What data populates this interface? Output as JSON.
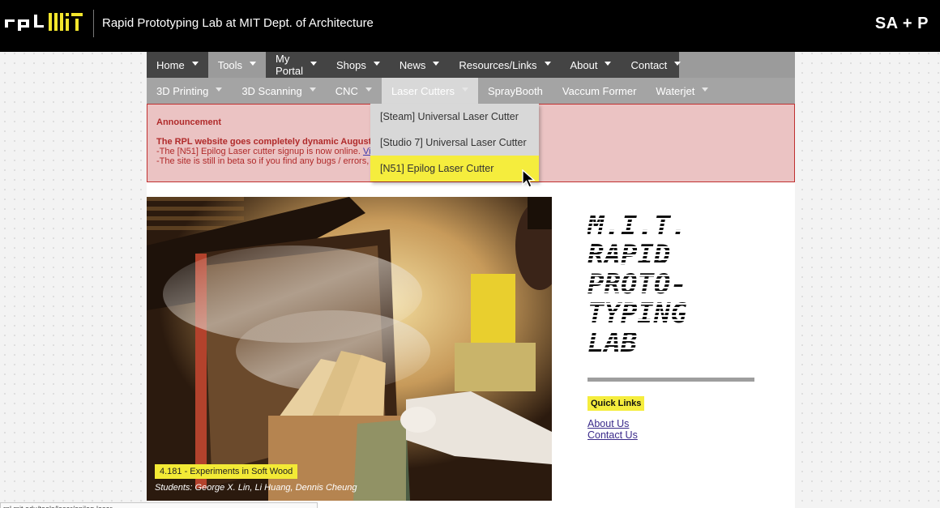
{
  "header": {
    "site_title": "Rapid Prototyping Lab at MIT Dept. of Architecture",
    "right_label": "SA + P",
    "logos": [
      "rpl-logo",
      "mit-logo"
    ]
  },
  "nav": {
    "primary": [
      {
        "label": "Home",
        "active": false
      },
      {
        "label": "Tools",
        "active": true
      },
      {
        "label": "My Portal",
        "active": false
      },
      {
        "label": "Shops",
        "active": false
      },
      {
        "label": "News",
        "active": false
      },
      {
        "label": "Resources/Links",
        "active": false
      },
      {
        "label": "About",
        "active": false
      },
      {
        "label": "Contact",
        "active": false
      }
    ],
    "secondary": [
      {
        "label": "3D Printing",
        "has_caret": true
      },
      {
        "label": "3D Scanning",
        "has_caret": true
      },
      {
        "label": "CNC",
        "has_caret": true
      },
      {
        "label": "Laser Cutters",
        "has_caret": true,
        "active": true
      },
      {
        "label": "SprayBooth",
        "has_caret": false
      },
      {
        "label": "Vaccum Former",
        "has_caret": false
      },
      {
        "label": "Waterjet",
        "has_caret": true
      }
    ],
    "dropdown": [
      {
        "label": "[Steam] Universal Laser Cutter",
        "highlighted": false
      },
      {
        "label": "[Studio 7] Universal Laser Cutter",
        "highlighted": false
      },
      {
        "label": "[N51] Epilog Laser Cutter",
        "highlighted": true
      }
    ]
  },
  "announcement": {
    "title": "Announcement",
    "line1": "The RPL website goes completely dynamic August 15,",
    "line2": "-The [N51] Epilog Laser cutter signup is now online.",
    "line2_link": "View",
    "line3": "-The site is still in beta so if you find any bugs / errors, ple"
  },
  "photo": {
    "caption": "4.181 - Experiments in Soft Wood",
    "credits": "Students: George X. Lin, Li Huang, Dennis Cheung"
  },
  "sidebar": {
    "big_title_lines": [
      "M.I.T.",
      "RAPID",
      "PROTO-",
      "TYPING",
      "LAB"
    ],
    "quick_links_label": "Quick Links",
    "links": [
      "About Us",
      "Contact Us"
    ]
  },
  "status": {
    "url": "rpl.mit.edu/tools/laser/epilog-laser"
  },
  "colors": {
    "accent_yellow": "#f5ed3d",
    "announce_bg": "#ebc3c3",
    "announce_text": "#b02a2a",
    "nav_dark": "#444444",
    "nav_gray": "#9b9b9b"
  }
}
